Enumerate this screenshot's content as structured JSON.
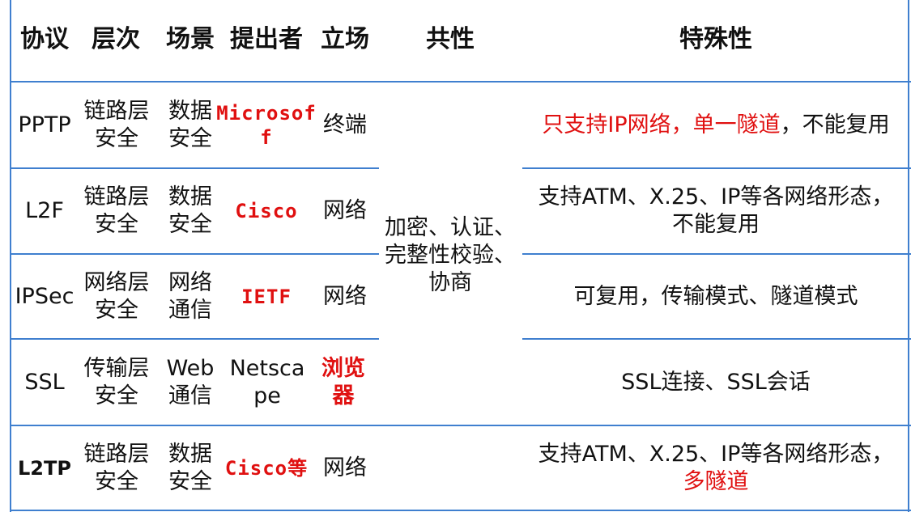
{
  "headers": [
    "协议",
    "层次",
    "场景",
    "提出者",
    "立场",
    "共性",
    "特殊性"
  ],
  "common": "加密、认证、完整性校验、协商",
  "rows": [
    {
      "protocol": "PPTP",
      "layer": "链路层安全",
      "scene": "数据安全",
      "proposer": "Microsof",
      "proposer2": "f",
      "stance": "终端",
      "special": [
        {
          "t": "只支持IP网络，单一隧道",
          "red": true
        },
        {
          "t": "，不能复用",
          "red": false
        }
      ]
    },
    {
      "protocol": "L2F",
      "layer": "链路层安全",
      "scene": "数据安全",
      "proposer": "Cisco",
      "stance": "网络",
      "special_line1": "支持ATM、X.25、IP等各网络形态，",
      "special_line2": "不能复用"
    },
    {
      "protocol": "IPSec",
      "layer": "网络层安全",
      "scene": "网络通信",
      "proposer": "IETF",
      "stance": "网络",
      "special_line1": "可复用，传输模式、隧道模式"
    },
    {
      "protocol": "SSL",
      "layer": "传输层安全",
      "scene": "Web通信",
      "proposer": "Netscape",
      "stance": "浏览器",
      "special_line1": "SSL连接、SSL会话"
    },
    {
      "protocol": "L2TP",
      "layer": "链路层安全",
      "scene": "数据安全",
      "proposer": "Cisco等",
      "stance": "网络",
      "special_line1": "支持ATM、X.25、IP等各网络形态，",
      "special_line2": "多隧道"
    }
  ]
}
